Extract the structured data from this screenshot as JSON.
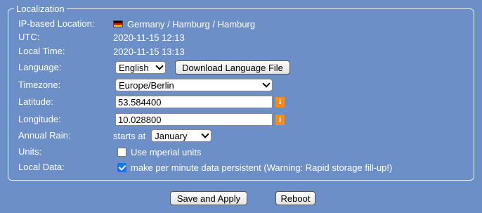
{
  "fieldset": {
    "legend": "Localization"
  },
  "ip_location": {
    "label": "IP-based Location:",
    "value": "Germany / Hamburg / Hamburg",
    "flag_icon": "germany-flag-icon"
  },
  "utc": {
    "label": "UTC:",
    "value": "2020-11-15 12:13"
  },
  "local_time": {
    "label": "Local Time:",
    "value": "2020-11-15 13:13"
  },
  "language": {
    "label": "Language:",
    "selected": "English",
    "download_button": "Download Language File"
  },
  "timezone": {
    "label": "Timezone:",
    "selected": "Europe/Berlin"
  },
  "latitude": {
    "label": "Latitude:",
    "value": "53.584400",
    "info": "i"
  },
  "longitude": {
    "label": "Longitude:",
    "value": "10.028800",
    "info": "i"
  },
  "annual_rain": {
    "label": "Annual Rain:",
    "prefix": "starts at",
    "selected": "January"
  },
  "units": {
    "label": "Units:",
    "checkbox_label": "Use mperial units",
    "checked": false
  },
  "local_data": {
    "label": "Local Data:",
    "checkbox_label": "make per minute data persistent (Warning: Rapid storage fill-up!)",
    "checked": true
  },
  "actions": {
    "save_label": "Save and Apply",
    "reboot_label": "Reboot"
  },
  "colors": {
    "background": "#6c8fc8",
    "text": "#ffffff",
    "info_badge": "#f28c1e",
    "checkbox_checked": "#1a73e8"
  }
}
